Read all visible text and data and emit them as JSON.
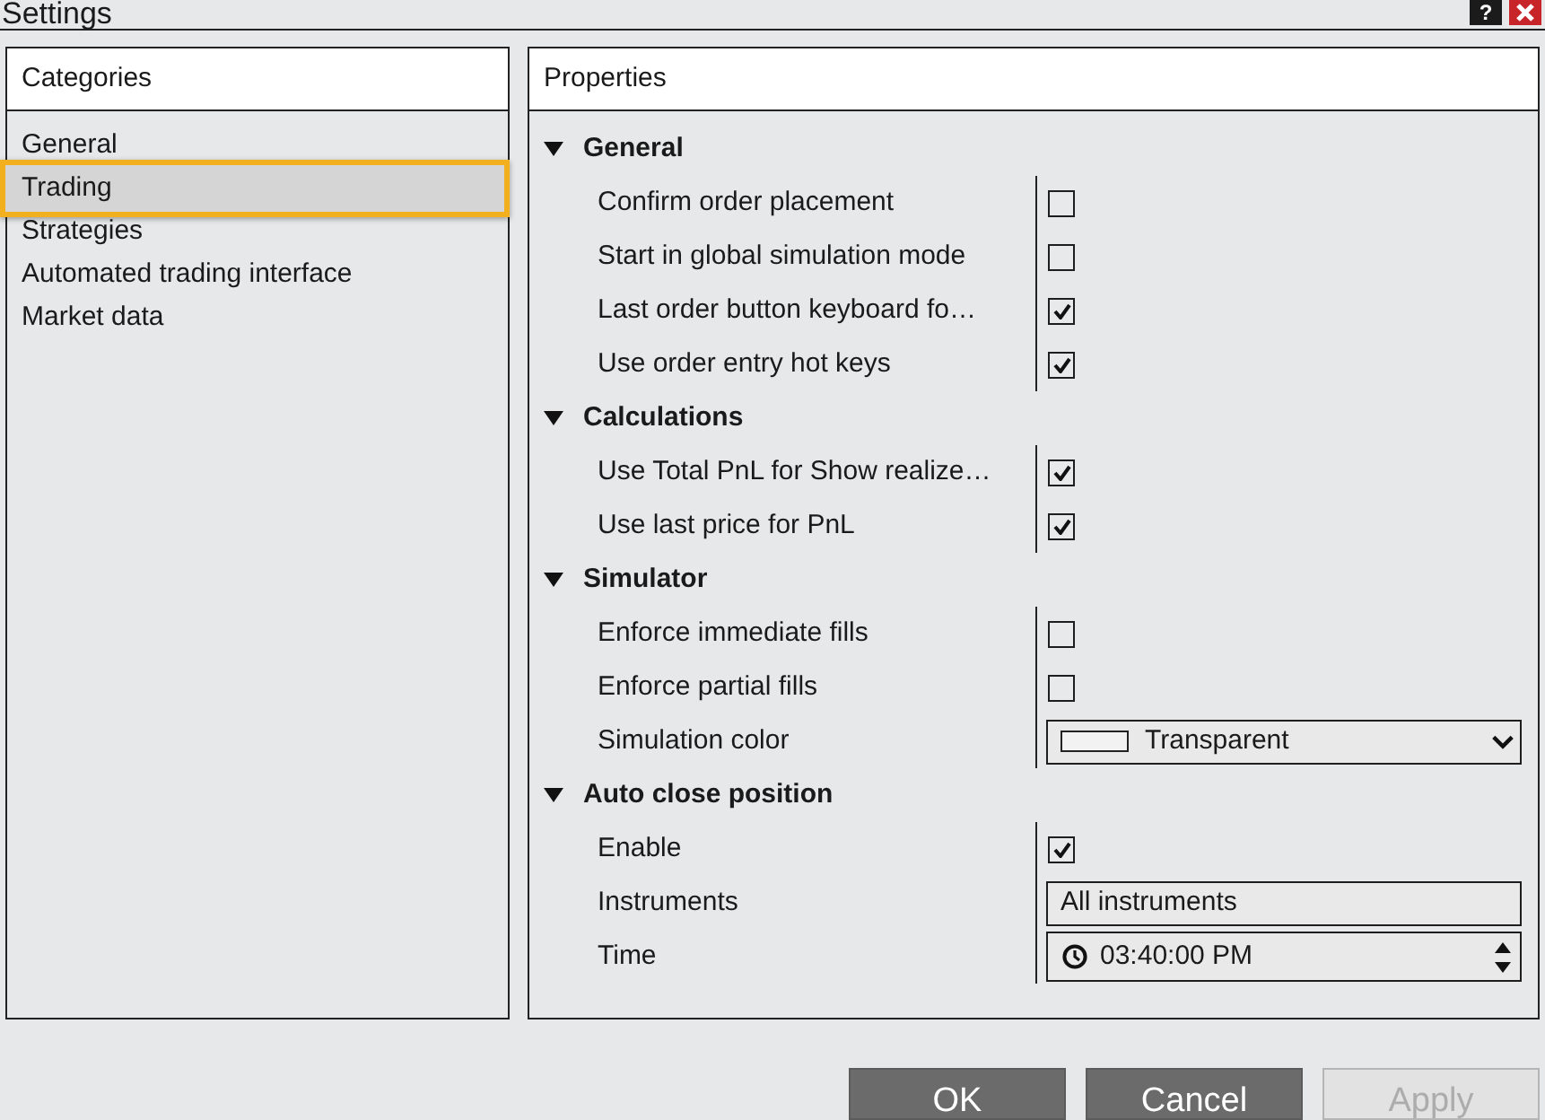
{
  "window": {
    "title": "Settings",
    "help_label": "?"
  },
  "categories": {
    "title": "Categories",
    "items": [
      {
        "label": "General",
        "selected": false
      },
      {
        "label": "Trading",
        "selected": true
      },
      {
        "label": "Strategies",
        "selected": false
      },
      {
        "label": "Automated trading interface",
        "selected": false
      },
      {
        "label": "Market data",
        "selected": false
      }
    ]
  },
  "properties": {
    "title": "Properties",
    "groups": [
      {
        "title": "General",
        "expanded": true,
        "rows": [
          {
            "label": "Confirm order placement",
            "kind": "checkbox",
            "checked": false
          },
          {
            "label": "Start in global simulation mode",
            "kind": "checkbox",
            "checked": false
          },
          {
            "label": "Last order button keyboard fo…",
            "kind": "checkbox",
            "checked": true
          },
          {
            "label": "Use order entry hot keys",
            "kind": "checkbox",
            "checked": true
          }
        ]
      },
      {
        "title": "Calculations",
        "expanded": true,
        "rows": [
          {
            "label": "Use Total PnL for Show realize…",
            "kind": "checkbox",
            "checked": true
          },
          {
            "label": "Use last price for PnL",
            "kind": "checkbox",
            "checked": true
          }
        ]
      },
      {
        "title": "Simulator",
        "expanded": true,
        "rows": [
          {
            "label": "Enforce immediate fills",
            "kind": "checkbox",
            "checked": false
          },
          {
            "label": "Enforce partial fills",
            "kind": "checkbox",
            "checked": false
          },
          {
            "label": "Simulation color",
            "kind": "dropdown",
            "value": "Transparent"
          }
        ]
      },
      {
        "title": "Auto close position",
        "expanded": true,
        "rows": [
          {
            "label": "Enable",
            "kind": "checkbox",
            "checked": true
          },
          {
            "label": "Instruments",
            "kind": "text",
            "value": "All instruments"
          },
          {
            "label": "Time",
            "kind": "time",
            "value": "03:40:00 PM"
          }
        ]
      }
    ]
  },
  "buttons": [
    {
      "label": "OK",
      "disabled": false
    },
    {
      "label": "Cancel",
      "disabled": false
    },
    {
      "label": "Apply",
      "disabled": true
    }
  ]
}
